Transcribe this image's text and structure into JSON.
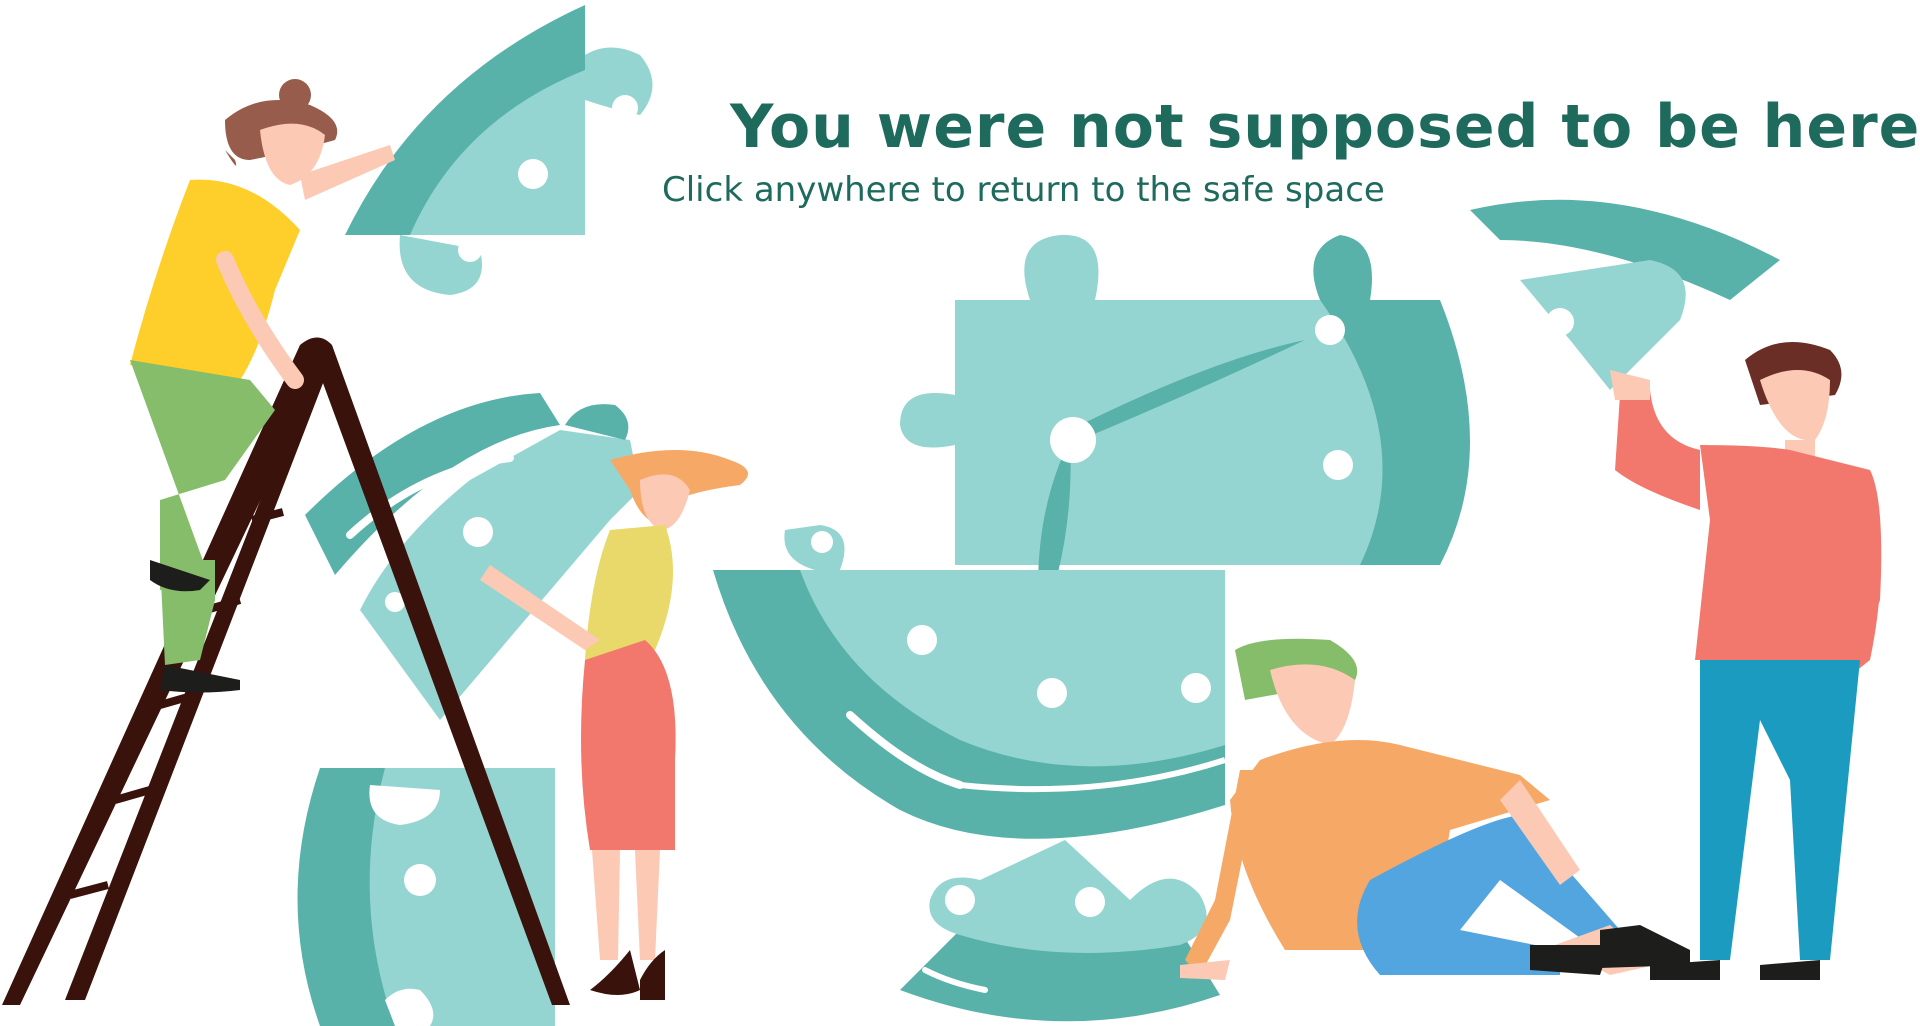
{
  "message": {
    "title": "You were not supposed to be here!",
    "subtitle": "Click anywhere to return to the safe space"
  },
  "illustration": {
    "name": "puzzle-team-illustration",
    "colors": {
      "teal_dark": "#58b2aa",
      "teal_light": "#95d5d1",
      "title_green": "#1e6b5e",
      "coral": "#f2786d",
      "yellow": "#fecf2a",
      "orange": "#f6a966",
      "blue": "#52a5de",
      "ladder": "#3a120c"
    }
  }
}
